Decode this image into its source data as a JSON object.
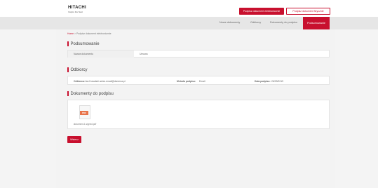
{
  "header": {
    "logo": "HITACHI",
    "logo_sub": "Inspire the Next",
    "primary_button": "Podpisz dokument elektronicznie",
    "outline_button": "Podpisz dokument fizycznie"
  },
  "nav": {
    "items": [
      "Nowe dokumenty",
      "Odbiorcy",
      "Dokumenty do podpisu"
    ],
    "active": "Podsumowanie"
  },
  "breadcrumb": {
    "home": "Home",
    "separator": ">",
    "current": "Podpisz dokument elektronicznie"
  },
  "summary": {
    "title": "Podsumowanie",
    "field_label": "Nazwa dokumentu",
    "field_value": "Umowa"
  },
  "recipients": {
    "title": "Odbiorcy",
    "recipient_label": "Odbiorca:",
    "recipient_value": "Jan Kowalski  adres.email@domena.pl",
    "method_label": "Metoda podpisu:",
    "method_value": "Email",
    "deadline_label": "Data podpisu:",
    "deadline_value": "26/09/2019"
  },
  "documents": {
    "title": "Dokumenty do podpisu",
    "file_badge": "PDF",
    "file_name": "dokument-1.signed.pdf"
  },
  "actions": {
    "back": "Wstecz"
  },
  "colors": {
    "accent": "#c8102e",
    "pdf": "#e8734a"
  }
}
